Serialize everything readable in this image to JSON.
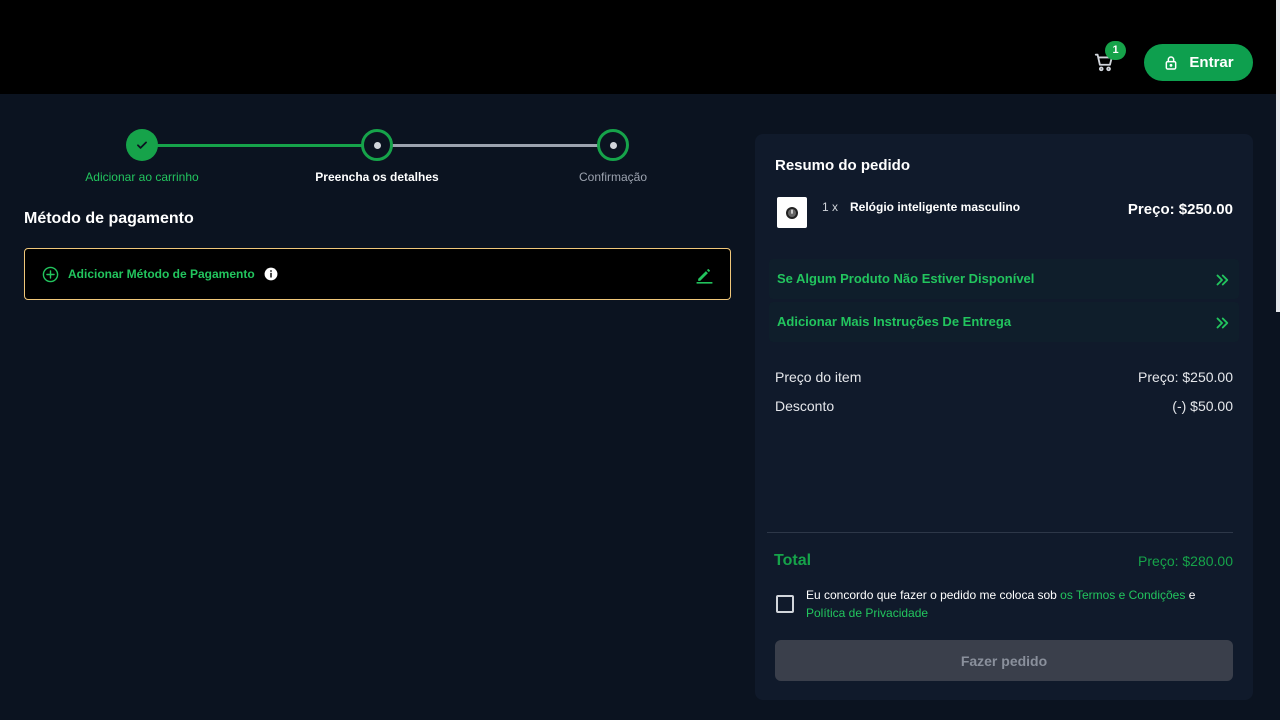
{
  "header": {
    "cart_count": "1",
    "login_label": "Entrar"
  },
  "stepper": {
    "steps": [
      {
        "label": "Adicionar ao carrinho"
      },
      {
        "label": "Preencha os detalhes"
      },
      {
        "label": "Confirmação"
      }
    ]
  },
  "payment": {
    "title": "Método de pagamento",
    "add_label": "Adicionar Método de Pagamento"
  },
  "summary": {
    "title": "Resumo do pedido",
    "item": {
      "qty": "1 x",
      "name": "Relógio inteligente masculino",
      "price": "Preço: $250.00"
    },
    "accordions": [
      {
        "label": "Se Algum Produto Não Estiver Disponível"
      },
      {
        "label": "Adicionar Mais Instruções De Entrega"
      }
    ],
    "item_price_label": "Preço do item",
    "item_price_value": "Preço: $250.00",
    "discount_label": "Desconto",
    "discount_value": "(-) $50.00",
    "total_label": "Total",
    "total_value": "Preço: $280.00",
    "terms_prefix": "Eu concordo que fazer o pedido me coloca sob ",
    "terms_link": "os Termos e Condições",
    "terms_and": " e",
    "privacy_link": "Política de Privacidade",
    "order_button": "Fazer pedido"
  },
  "colors": {
    "accent": "#16a34a",
    "background": "#0b1320",
    "panel": "#101a2b",
    "payment_border": "#f0c77a"
  }
}
